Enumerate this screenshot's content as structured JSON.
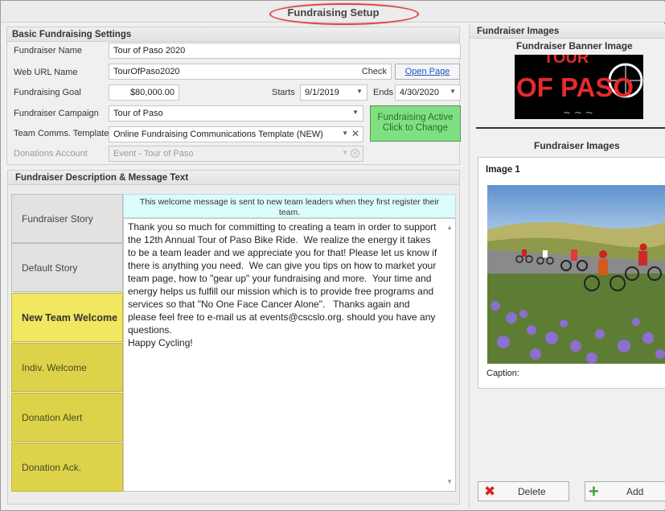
{
  "window": {
    "title": "Fundraising Setup"
  },
  "basic_settings": {
    "header": "Basic Fundraising Settings",
    "fundraiser_name_label": "Fundraiser Name",
    "fundraiser_name_value": "Tour of Paso 2020",
    "web_url_label": "Web URL Name",
    "web_url_value": "TourOfPaso2020",
    "check_label": "Check",
    "open_page_label": "Open Page",
    "goal_label": "Fundraising Goal",
    "goal_value": "$80,000.00",
    "starts_label": "Starts",
    "starts_value": "9/1/2019",
    "ends_label": "Ends",
    "ends_value": "4/30/2020",
    "campaign_label": "Fundraiser Campaign",
    "campaign_value": "Tour of Paso",
    "template_label": "Team Comms. Template",
    "template_value": "Online Fundraising Communications Template (NEW)",
    "donations_label": "Donations Account",
    "donations_value": "Event - Tour of Paso",
    "active_button_line1": "Fundraising Active",
    "active_button_line2": "Click to Change"
  },
  "description": {
    "header": "Fundraiser Description & Message Text",
    "tabs": [
      {
        "label": "Fundraiser Story"
      },
      {
        "label": "Default Story"
      },
      {
        "label": "New Team Welcome"
      },
      {
        "label": "Indiv. Welcome"
      },
      {
        "label": "Donation Alert"
      },
      {
        "label": "Donation Ack."
      }
    ],
    "info_text": "This welcome message is sent to new team leaders when they first register their team.",
    "message_text": "Thank you so much for committing to creating a team in order to support the 12th Annual Tour of Paso Bike Ride.  We realize the energy it takes to be a team leader and we appreciate you for that! Please let us know if there is anything you need.  We can give you tips on how to market your team page, how to \"gear up\" your fundraising and more.  Your time and energy helps us fulfill our mission which is to provide free programs and services so that \"No One Face Cancer Alone\".   Thanks again and please feel free to e-mail us at events@cscslo.org. should you have any questions.\nHappy Cycling!"
  },
  "images": {
    "header": "Fundraiser Images",
    "banner_title": "Fundraiser Banner Image",
    "banner_text": "OF PASO",
    "banner_top_text": "TOUR",
    "gallery_title": "Fundraiser Images",
    "image_label": "Image 1",
    "caption_label": "Caption:",
    "delete_label": "Delete",
    "add_label": "Add"
  },
  "colors": {
    "active_tab": "#f1e760",
    "tab_yellow": "#dcd34a",
    "active_button": "#7fe082",
    "highlight_ellipse": "#d9453f",
    "info_bar": "#dcfbfb",
    "link": "#1a56c7"
  }
}
